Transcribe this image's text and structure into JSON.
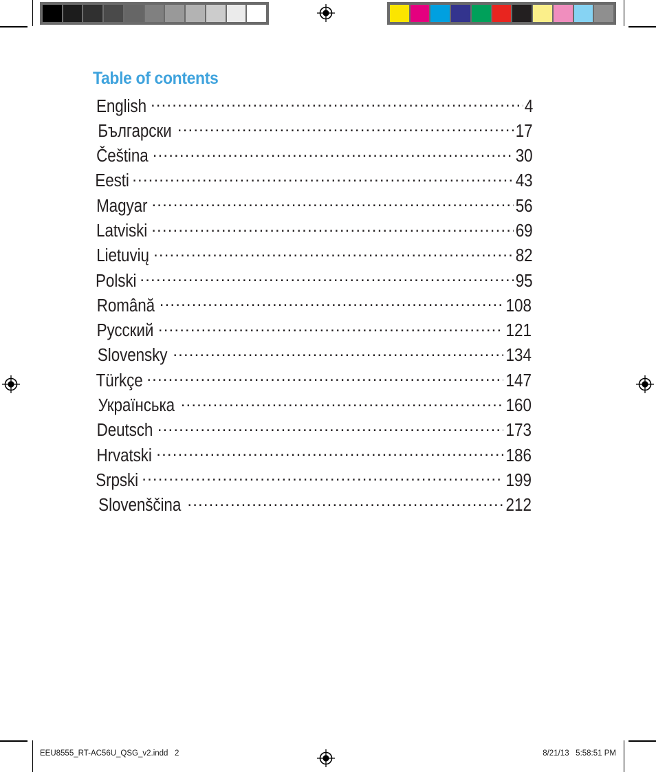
{
  "document": {
    "title": "Table of contents"
  },
  "toc": {
    "entries": [
      {
        "language": "English",
        "page": "4"
      },
      {
        "language": "Български",
        "page": "17"
      },
      {
        "language": "Čeština",
        "page": "30"
      },
      {
        "language": "Eesti",
        "page": "43"
      },
      {
        "language": "Magyar",
        "page": "56"
      },
      {
        "language": "Latviski",
        "page": "69"
      },
      {
        "language": "Lietuvių",
        "page": "82"
      },
      {
        "language": "Polski",
        "page": "95"
      },
      {
        "language": "Română",
        "page": "108"
      },
      {
        "language": "Русский",
        "page": "121"
      },
      {
        "language": "Slovensky",
        "page": "134"
      },
      {
        "language": "Türkçe",
        "page": "147"
      },
      {
        "language": "Українська",
        "page": "160"
      },
      {
        "language": "Deutsch",
        "page": "173"
      },
      {
        "language": "Hrvatski",
        "page": "186"
      },
      {
        "language": "Srpski",
        "page": "199"
      },
      {
        "language": "Slovenščina",
        "page": "212"
      }
    ]
  },
  "footer": {
    "file_label": "EEU8555_RT-AC56U_QSG_v2.indd   2",
    "timestamp": "8/21/13   5:58:51 PM"
  },
  "print_marks": {
    "grayscale_patches": [
      "#000000",
      "#1c1c1c",
      "#303030",
      "#4a4a4a",
      "#666666",
      "#808080",
      "#999999",
      "#b3b3b3",
      "#cccccc",
      "#ebebeb",
      "#ffffff"
    ],
    "color_patches": [
      "#fbe500",
      "#e4007f",
      "#00a0e0",
      "#33348e",
      "#00a05a",
      "#e8251f",
      "#231f20",
      "#fbef8a",
      "#f08ebe",
      "#86d3f3",
      "#8f8f8f"
    ],
    "registration_icon": "registration-target-icon"
  }
}
